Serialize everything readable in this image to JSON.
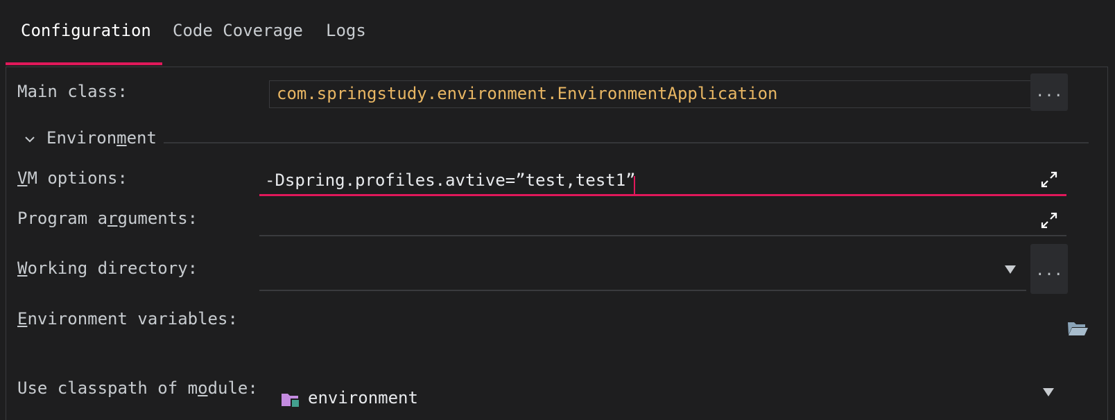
{
  "tabs": [
    {
      "label": "Configuration",
      "active": true
    },
    {
      "label": "Code Coverage",
      "active": false
    },
    {
      "label": "Logs",
      "active": false
    }
  ],
  "main_class": {
    "label": "Main class:",
    "value": "com.springstudy.environment.EnvironmentApplication",
    "browse_label": "..."
  },
  "environment_section": {
    "title_pre": "Environ",
    "title_mnemonic": "m",
    "title_post": "ent",
    "expanded": true
  },
  "vm_options": {
    "label_mnemonic": "V",
    "label_rest": "M options:",
    "value": "-Dspring.profiles.avtive=”test,test1”"
  },
  "program_arguments": {
    "label_pre": "Program a",
    "label_mnemonic": "r",
    "label_post": "guments:",
    "value": ""
  },
  "working_directory": {
    "label_mnemonic": "W",
    "label_rest": "orking directory:",
    "value": "",
    "browse_label": "..."
  },
  "environment_variables": {
    "label_mnemonic": "E",
    "label_rest": "nvironment variables:"
  },
  "classpath_module": {
    "label_pre": "Use classpath of m",
    "label_mnemonic": "o",
    "label_post": "dule:",
    "value": "environment"
  },
  "colors": {
    "accent": "#e0185a",
    "background": "#1e1e1f",
    "class_name": "#e8b663",
    "folder_icon": "#c48be0",
    "module_badge": "#43a08f"
  },
  "icons": {
    "expand": "expand-arrows-icon",
    "dropdown": "triangle-down-icon",
    "folder": "open-folder-icon",
    "module": "module-folder-icon",
    "chevron": "chevron-down-icon"
  }
}
